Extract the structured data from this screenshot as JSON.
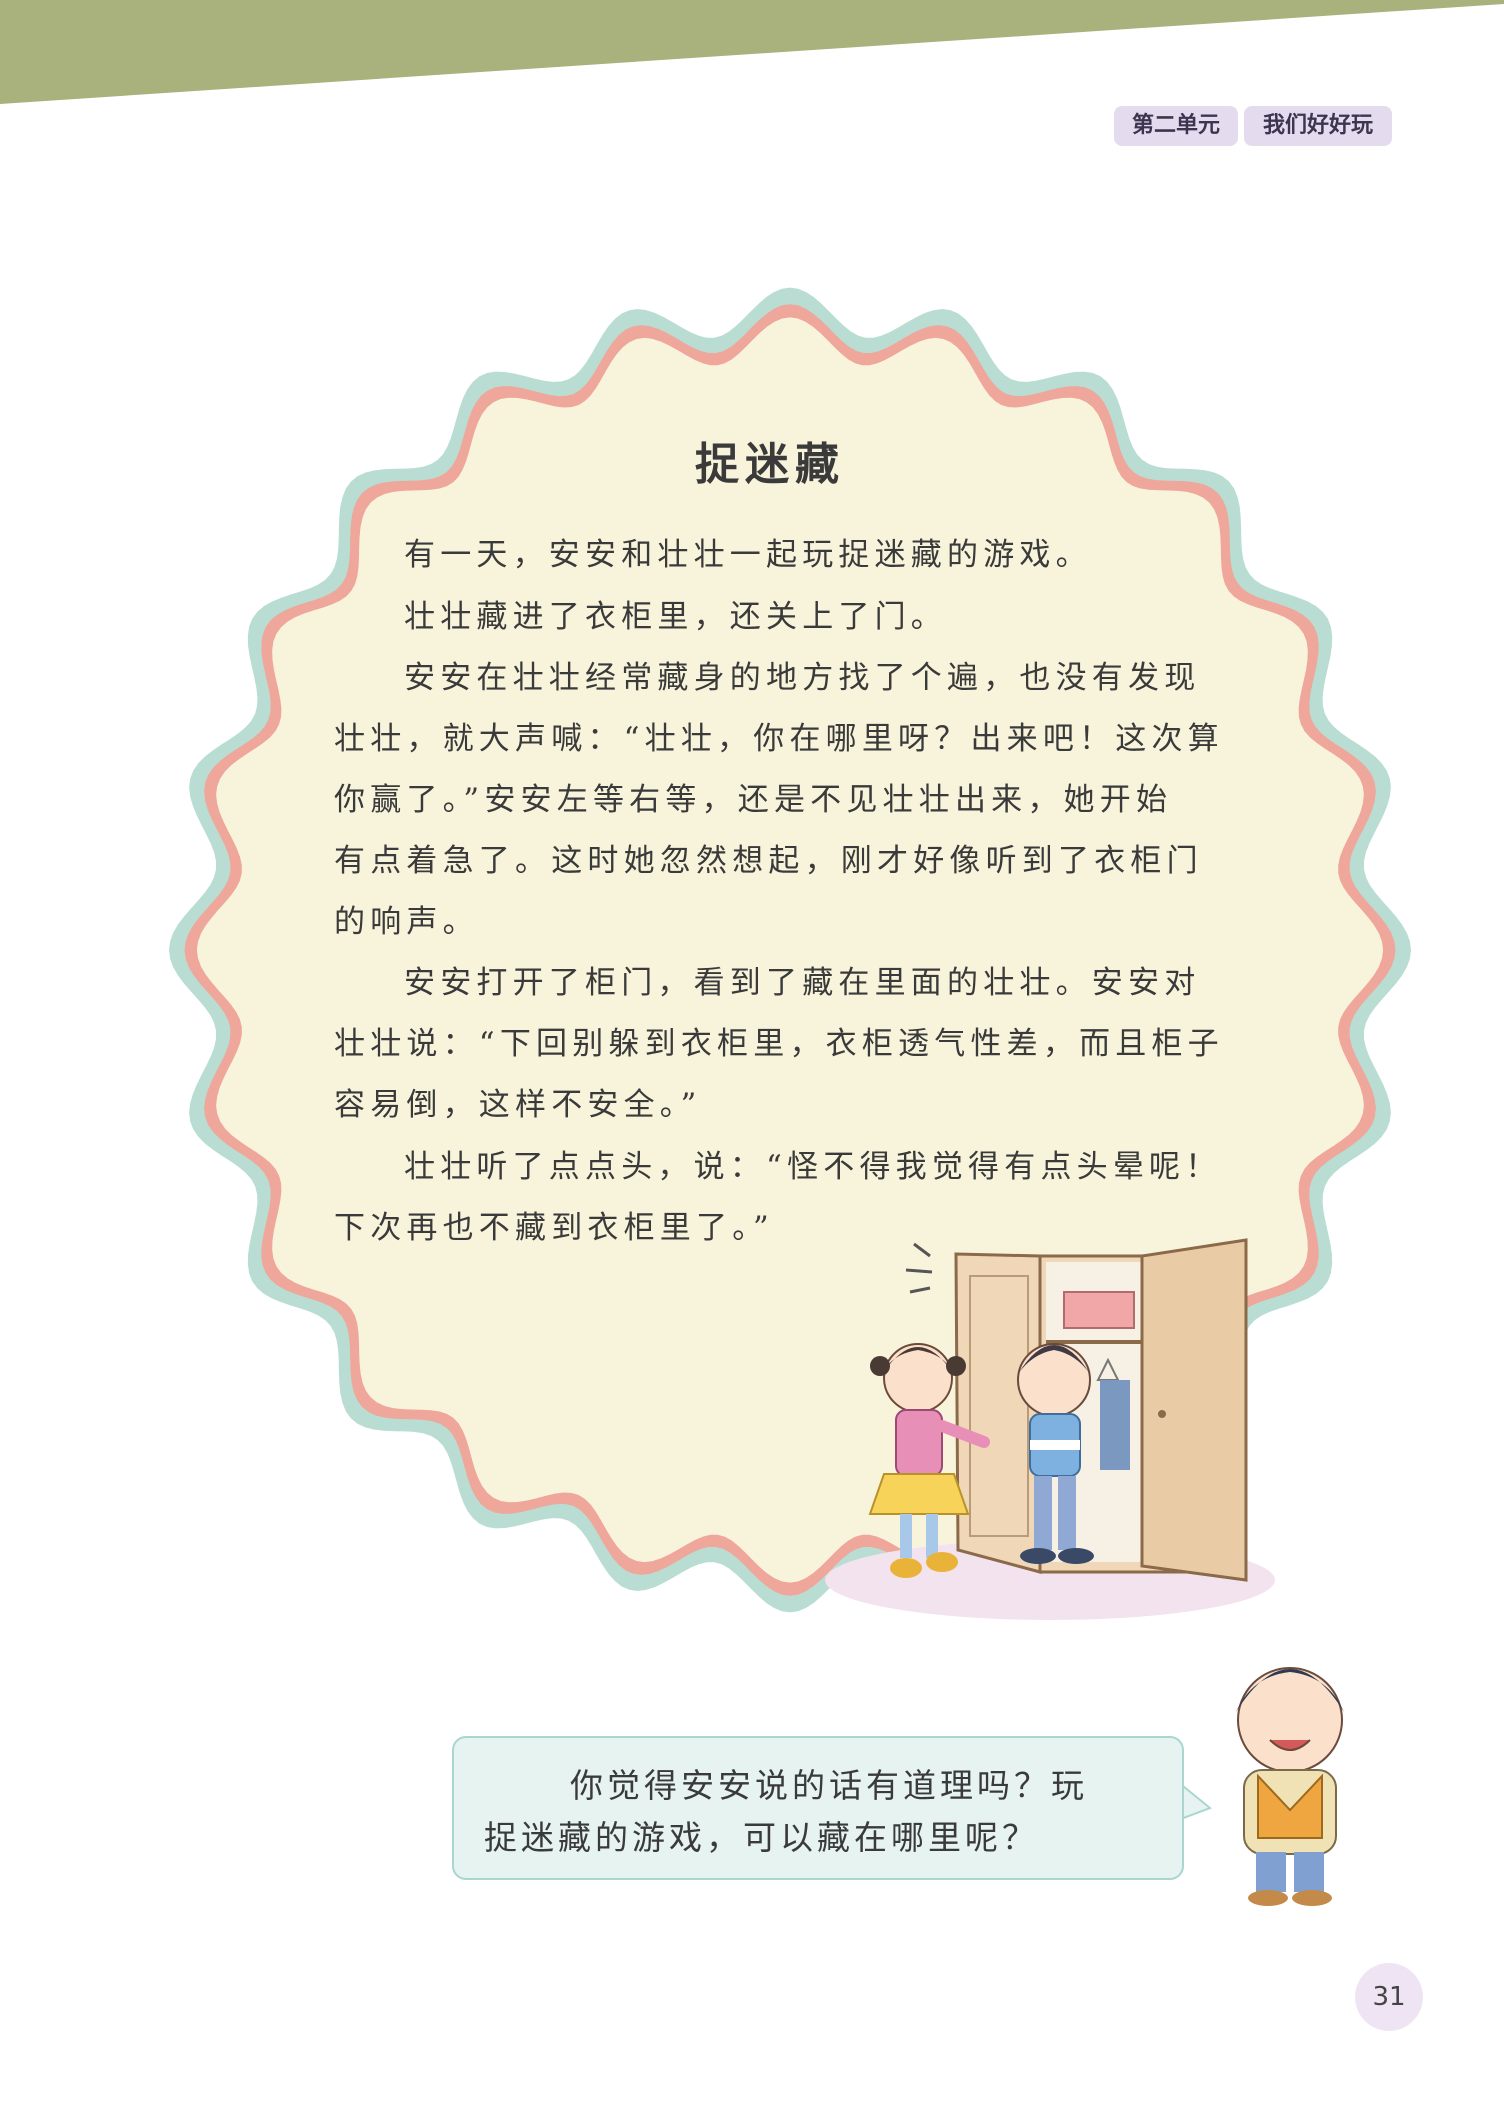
{
  "header": {
    "unit_number": "第二单元",
    "unit_title": "我们好好玩"
  },
  "story": {
    "title": "捉迷藏",
    "lines": [
      "有一天，安安和壮壮一起玩捉迷藏的游戏。",
      "壮壮藏进了衣柜里，还关上了门。",
      "安安在壮壮经常藏身的地方找了个遍，也没有发现",
      "壮壮，就大声喊：“壮壮，你在哪里呀？出来吧！这次算",
      "你赢了。”安安左等右等，还是不见壮壮出来，她开始",
      "有点着急了。这时她忽然想起，刚才好像听到了衣柜门",
      "的响声。",
      "安安打开了柜门，看到了藏在里面的壮壮。安安对",
      "壮壮说：“下回别躲到衣柜里，衣柜透气性差，而且柜子",
      "容易倒，这样不安全。”",
      "壮壮听了点点头，说：“怪不得我觉得有点头晕呢！",
      "下次再也不藏到衣柜里了。”"
    ]
  },
  "question": {
    "line1": "你觉得安安说的话有道理吗？玩",
    "line2": "捉迷藏的游戏，可以藏在哪里呢？"
  },
  "page_number": "31",
  "colors": {
    "banner": "#a9b27c",
    "bubble_fill": "#f8f4dc",
    "bubble_outer": "#b9ddd3",
    "bubble_inner": "#eea79a",
    "unit_tab": "#e4dcee",
    "question_fill": "#e6f3f1",
    "question_border": "#a9d6cf"
  }
}
